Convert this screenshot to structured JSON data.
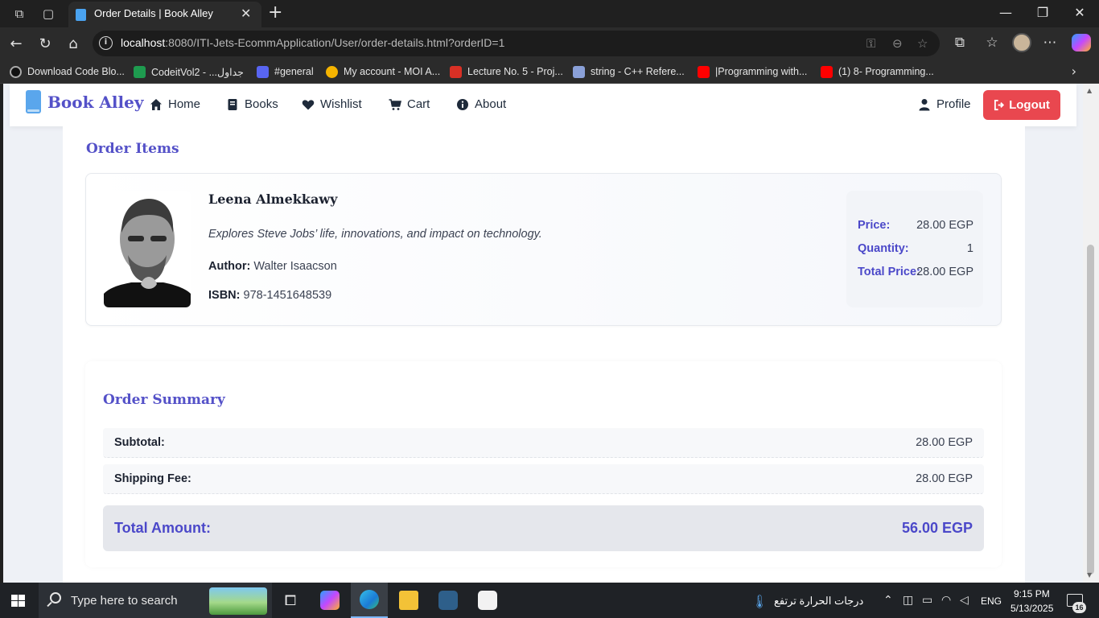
{
  "browser": {
    "tab_title": "Order Details | Book Alley",
    "url_host": "localhost",
    "url_rest": ":8080/ITI-Jets-EcommApplication/User/order-details.html?orderID=1",
    "bookmarks": [
      {
        "label": "Download Code Blo...",
        "color": "#111111"
      },
      {
        "label": "CodeitVol2 - ...جداول",
        "color": "#1e9b4f"
      },
      {
        "label": "#general",
        "color": "#5865f2"
      },
      {
        "label": "My account - MOI A...",
        "color": "#f5b400"
      },
      {
        "label": "Lecture No. 5 - Proj...",
        "color": "#d93025"
      },
      {
        "label": "string - C++ Refere...",
        "color": "#8aa0d8"
      },
      {
        "label": "|Programming with...",
        "color": "#ff0000"
      },
      {
        "label": "(1) 8- Programming...",
        "color": "#ff0000"
      }
    ]
  },
  "site": {
    "brand": "Book Alley",
    "nav": {
      "home": "Home",
      "books": "Books",
      "wishlist": "Wishlist",
      "cart": "Cart",
      "about": "About",
      "profile": "Profile",
      "logout": "Logout"
    },
    "colors": {
      "accent": "#5451c8",
      "logout": "#e9474f"
    }
  },
  "order_items": {
    "title": "Order Items",
    "items": [
      {
        "name": "Leena Almekkawy",
        "description": "Explores Steve Jobs’ life, innovations, and impact on technology.",
        "author_label": "Author:",
        "author": "Walter Isaacson",
        "isbn_label": "ISBN:",
        "isbn": "978-1451648539",
        "price_label": "Price:",
        "price": "28.00 EGP",
        "quantity_label": "Quantity:",
        "quantity": "1",
        "total_label": "Total Price:",
        "total": "28.00 EGP"
      }
    ]
  },
  "summary": {
    "title": "Order Summary",
    "subtotal_label": "Subtotal:",
    "subtotal": "28.00 EGP",
    "shipping_label": "Shipping Fee:",
    "shipping": "28.00 EGP",
    "total_label": "Total Amount:",
    "total": "56.00 EGP"
  },
  "taskbar": {
    "search_placeholder": "Type here to search",
    "weather": "درجات الحرارة ترتفع",
    "language": "ENG",
    "time": "9:15 PM",
    "date": "5/13/2025",
    "notification_count": "16"
  }
}
